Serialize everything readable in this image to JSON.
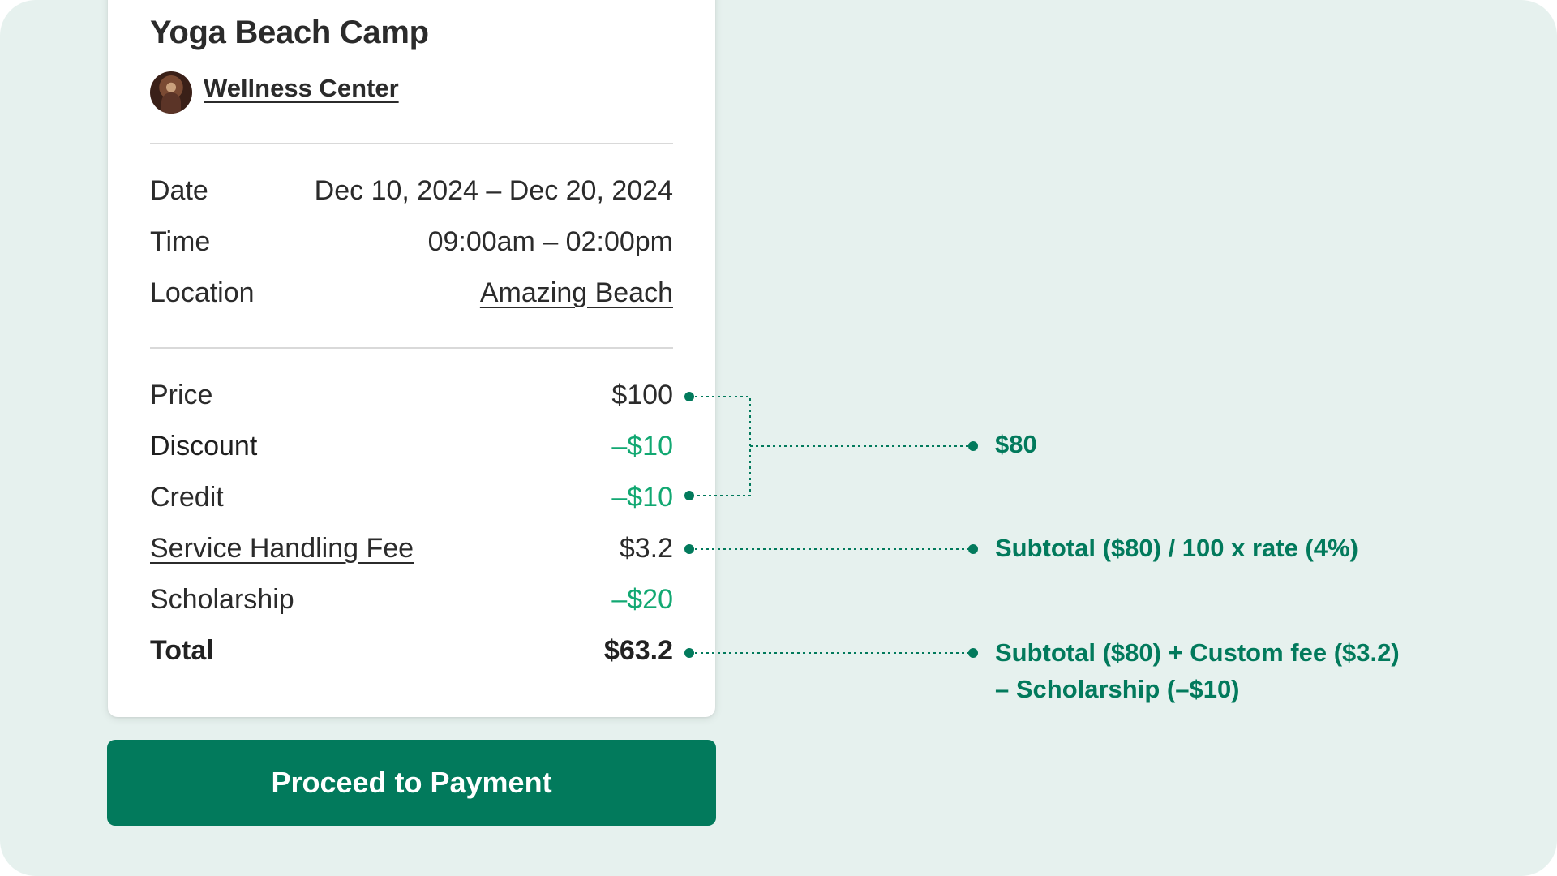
{
  "event": {
    "title": "Yoga Beach Camp",
    "organizer": "Wellness Center"
  },
  "details": [
    {
      "label": "Date",
      "value": "Dec 10, 2024 – Dec 20, 2024"
    },
    {
      "label": "Time",
      "value": "09:00am – 02:00pm"
    },
    {
      "label": "Location",
      "value": "Amazing Beach"
    }
  ],
  "pricing": [
    {
      "label": "Price",
      "value": "$100"
    },
    {
      "label": "Discount",
      "value": "–$10"
    },
    {
      "label": "Credit",
      "value": "–$10"
    },
    {
      "label": "Service Handling Fee",
      "value": "$3.2"
    },
    {
      "label": "Scholarship",
      "value": "–$20"
    },
    {
      "label": "Total",
      "value": "$63.2"
    }
  ],
  "annotations": {
    "subtotal": "$80",
    "fee_formula": "Subtotal ($80) / 100 x rate (4%)",
    "total_formula_line1": "Subtotal ($80) + Custom fee ($3.2)",
    "total_formula_line2": "– Scholarship (–$10)"
  },
  "actions": {
    "proceed_label": "Proceed to Payment"
  },
  "colors": {
    "background": "#e6f1ee",
    "accent": "#027a5c",
    "negative_amount": "#12a872",
    "text": "#2b2b2b"
  }
}
